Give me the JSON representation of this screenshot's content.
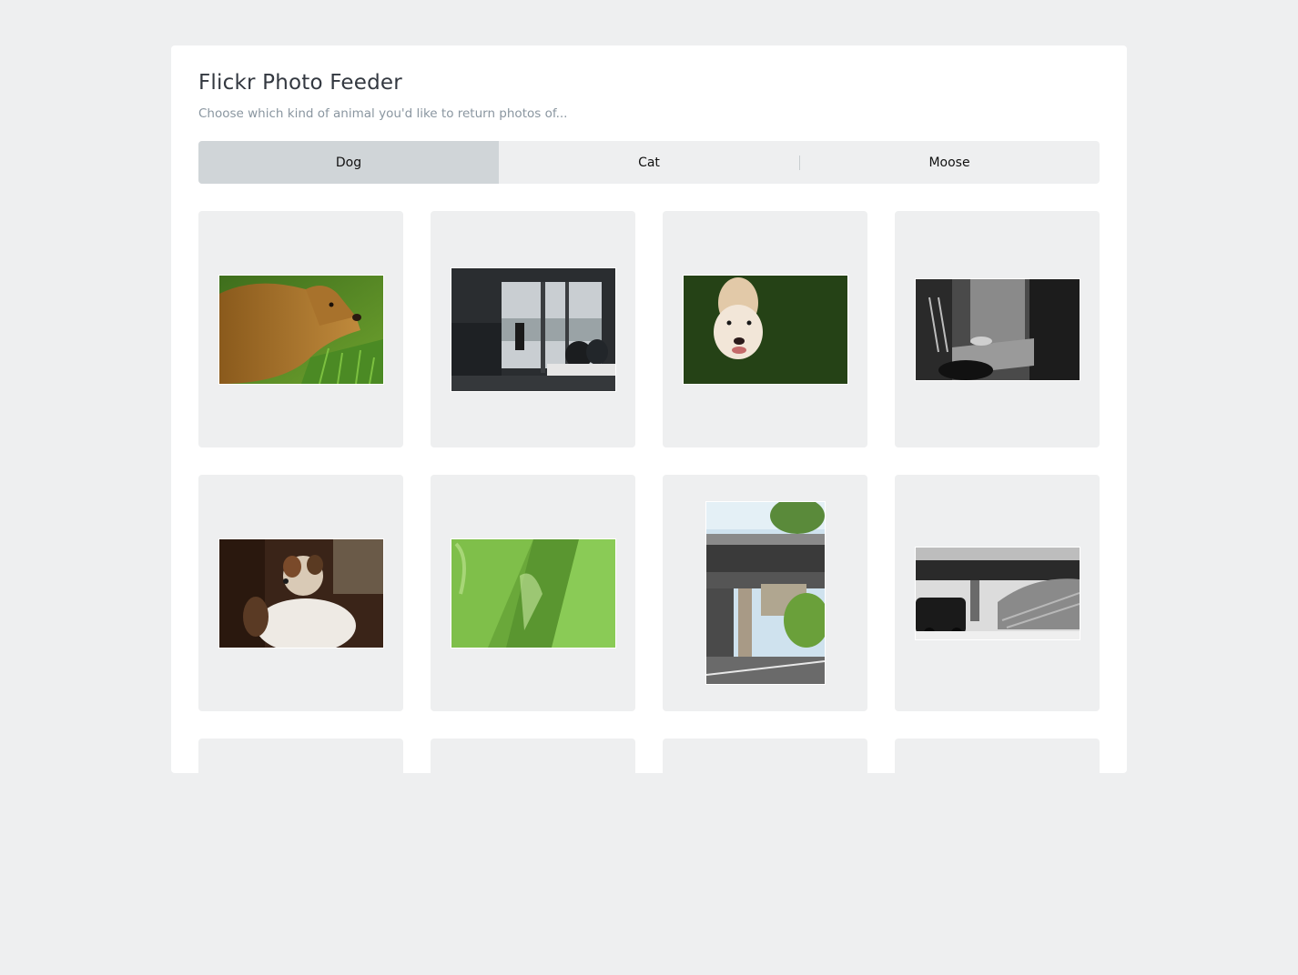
{
  "header": {
    "title": "Flickr Photo Feeder",
    "subtitle": "Choose which kind of animal you'd like to return photos of..."
  },
  "tabs": [
    {
      "label": "Dog",
      "active": true
    },
    {
      "label": "Cat",
      "active": false
    },
    {
      "label": "Moose",
      "active": false
    }
  ],
  "photos": [
    {
      "subject": "golden retriever in grass"
    },
    {
      "subject": "dog on apartment balcony"
    },
    {
      "subject": "white dog looking up on grass"
    },
    {
      "subject": "black and white cat on stairs"
    },
    {
      "subject": "fluffy terrier in chair"
    },
    {
      "subject": "green glass closeup"
    },
    {
      "subject": "overpass bridge with plants"
    },
    {
      "subject": "black and white overpass with car"
    },
    {
      "subject": "photo"
    },
    {
      "subject": "photo"
    },
    {
      "subject": "photo"
    },
    {
      "subject": "photo"
    }
  ]
}
